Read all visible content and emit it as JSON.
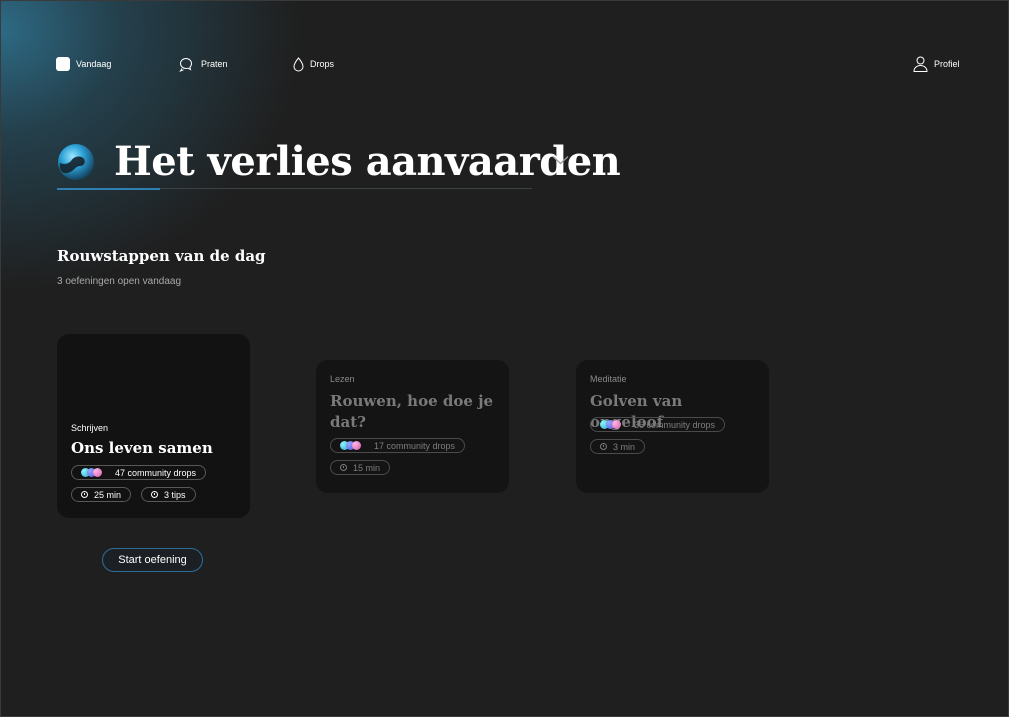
{
  "nav": {
    "today": "Vandaag",
    "talk": "Praten",
    "drops": "Drops",
    "profile": "Profiel"
  },
  "theme": {
    "title": "Het verlies aanvaarden"
  },
  "section": {
    "title": "Rouwstappen van de dag",
    "subtitle": "3 oefeningen open vandaag"
  },
  "cards": [
    {
      "category": "Schrijven",
      "title": "Ons leven samen",
      "drops": "47 community drops",
      "duration": "25 min",
      "tips": "3 tips"
    },
    {
      "category": "Lezen",
      "title": "Rouwen, hoe doe je dat?",
      "drops": "17 community drops",
      "duration": "15 min"
    },
    {
      "category": "Meditatie",
      "title": "Golven van ongeloof",
      "drops": "36 community drops",
      "duration": "3 min"
    }
  ],
  "actions": {
    "start": "Start oefening"
  },
  "colors": {
    "background": "#1f1f1f",
    "accent": "#2f7fb2",
    "card": "#141414"
  },
  "icons": {
    "today": "square-icon",
    "talk": "chat-bubbles-icon",
    "drops": "drop-icon",
    "profile": "person-icon",
    "theme": "wave-logo",
    "chevron": "chevron-down-icon",
    "clock": "clock-icon",
    "avatars": "community-dots"
  }
}
